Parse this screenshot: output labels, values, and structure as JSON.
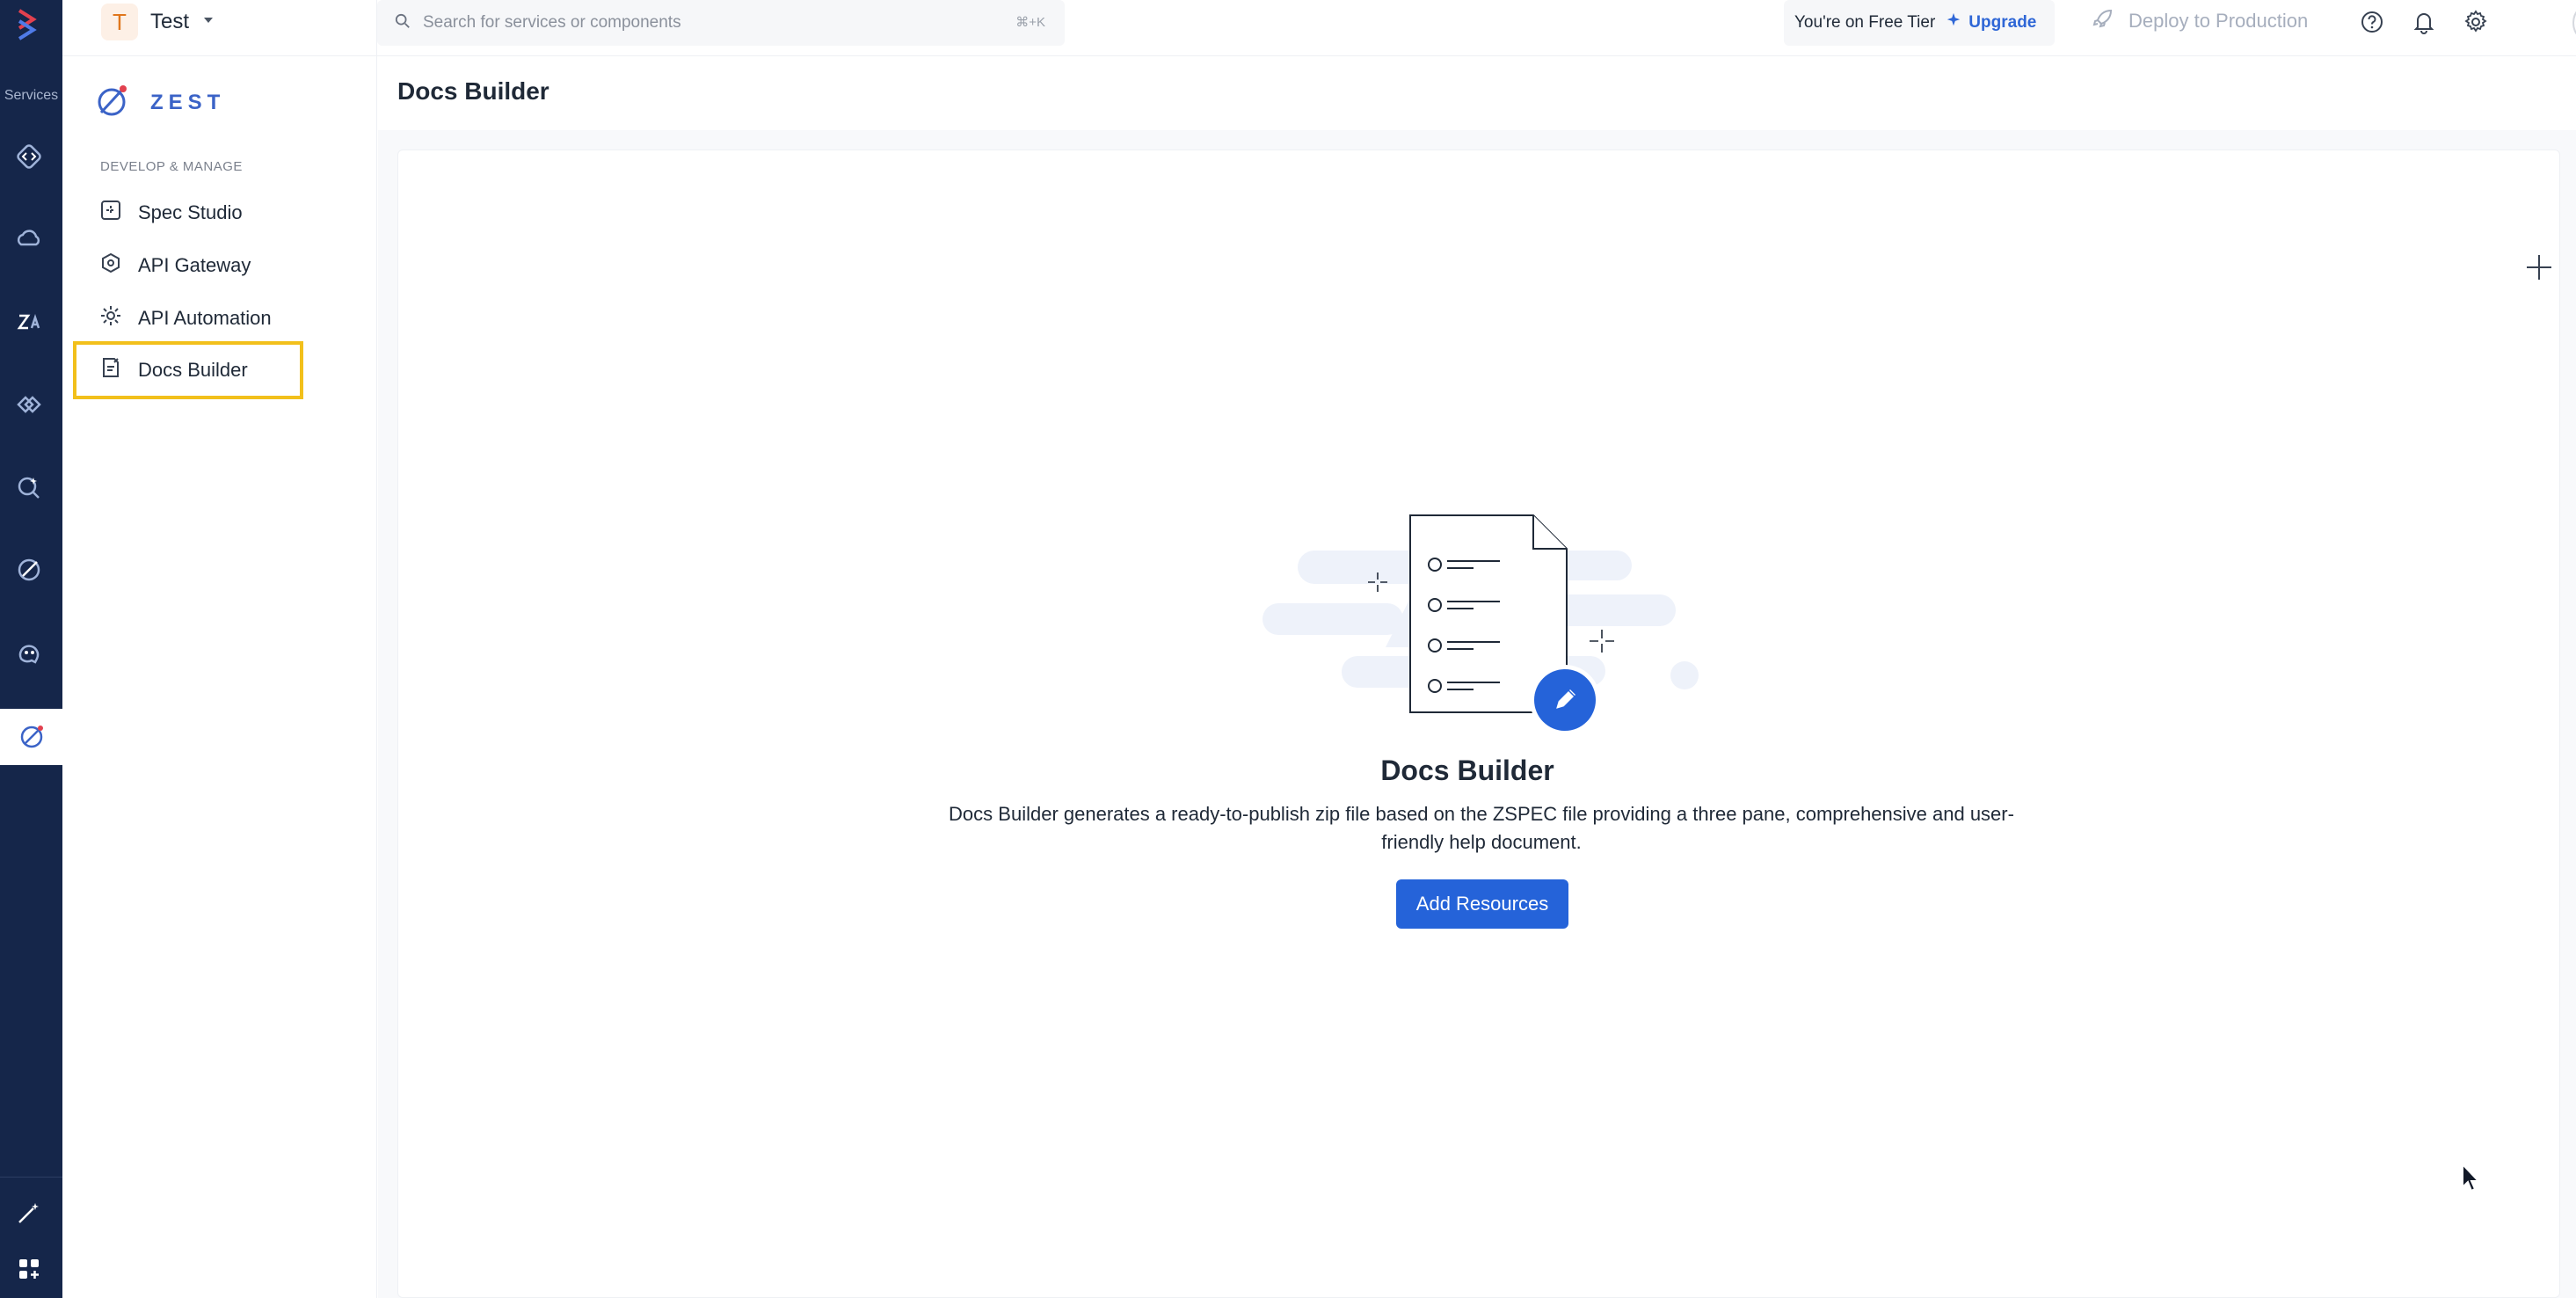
{
  "rail": {
    "services_label": "Services",
    "icons": [
      "code-icon",
      "cloud-icon",
      "translate-icon",
      "hands-icon",
      "chat-search-icon",
      "zest-icon",
      "bot-icon",
      "zest-active-icon",
      "magic-wand-icon",
      "apps-icon"
    ]
  },
  "workspace": {
    "initial": "T",
    "name": "Test"
  },
  "search": {
    "placeholder": "Search for services or components",
    "shortcut": "⌘+K"
  },
  "tier": {
    "text": "You're on Free Tier",
    "upgrade": "Upgrade"
  },
  "deploy": {
    "label": "Deploy to Production"
  },
  "sidebar": {
    "brand": "ZEST",
    "section": "DEVELOP & MANAGE",
    "items": [
      {
        "label": "Spec Studio",
        "icon": "spec-studio-icon"
      },
      {
        "label": "API Gateway",
        "icon": "api-gateway-icon"
      },
      {
        "label": "API Automation",
        "icon": "api-automation-icon"
      },
      {
        "label": "Docs Builder",
        "icon": "docs-builder-icon",
        "active": true
      }
    ]
  },
  "page": {
    "title": "Docs Builder"
  },
  "empty_state": {
    "title": "Docs Builder",
    "description": "Docs Builder generates a ready-to-publish zip file based on the ZSPEC file providing a three pane, comprehensive and user-friendly help document.",
    "button": "Add Resources"
  },
  "colors": {
    "rail": "#15264a",
    "accent": "#2563d9",
    "highlight": "#f2c01b"
  }
}
